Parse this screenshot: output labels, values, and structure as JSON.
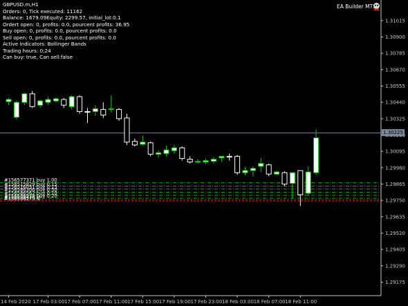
{
  "window": {
    "symbol_title": "GBPUSD.m,H1",
    "ea_label": "EA Builder MTS"
  },
  "info_lines": [
    "Orders: 0, Tick executed: 11162",
    "Balance: 1679.09Equity: 2299.57, initial_lot:0.1",
    "Ordert open: 0, profits: 0.0, pourcent profits: 36.95",
    "Buy open: 0, profits: 0.0, pourcent profits: 0.0",
    "Sell open: 0, profits: 0.0, pourcent profits: 0.0",
    "Active indicators: Bollinger Bands",
    "Trading hours: 0;24",
    "Can buy: true, Can sell:false"
  ],
  "colors": {
    "background": "#000000",
    "axis": "#c8c8c8",
    "bull_body": "#ffffff",
    "bear_body": "#000000",
    "wick_bull": "#00c800",
    "wick_bear": "#ffffff",
    "order_line": "#00aa00",
    "stop_line": "#ff0000",
    "bid_line": "#778899"
  },
  "chart_data": {
    "type": "candlestick",
    "symbol": "GBPUSD.m",
    "timeframe": "H1",
    "ylim": [
      1.2908,
      1.3116
    ],
    "y_ticks": [
      "1.31015",
      "1.30900",
      "1.30785",
      "1.30670",
      "1.30555",
      "1.30440",
      "1.30325",
      "1.30210",
      "1.30095",
      "1.29980",
      "1.29865",
      "1.29750",
      "1.29635",
      "1.29520",
      "1.29405",
      "1.29290",
      "1.29175"
    ],
    "x_ticks": [
      {
        "bar": 0,
        "label": "14 Feb 2020"
      },
      {
        "bar": 5,
        "label": "17 Feb 03:00"
      },
      {
        "bar": 9,
        "label": "17 Feb 07:00"
      },
      {
        "bar": 13,
        "label": "17 Feb 11:00"
      },
      {
        "bar": 17,
        "label": "17 Feb 15:00"
      },
      {
        "bar": 21,
        "label": "17 Feb 19:00"
      },
      {
        "bar": 25,
        "label": "17 Feb 23:00"
      },
      {
        "bar": 29,
        "label": "18 Feb 03:00"
      },
      {
        "bar": 33,
        "label": "18 Feb 07:00"
      },
      {
        "bar": 37,
        "label": "18 Feb 11:00"
      }
    ],
    "candles": [
      {
        "o": 1.30445,
        "h": 1.3047,
        "l": 1.3042,
        "c": 1.3046
      },
      {
        "o": 1.30335,
        "h": 1.3045,
        "l": 1.3032,
        "c": 1.3044
      },
      {
        "o": 1.3044,
        "h": 1.3051,
        "l": 1.3042,
        "c": 1.305
      },
      {
        "o": 1.305,
        "h": 1.3052,
        "l": 1.304,
        "c": 1.3041
      },
      {
        "o": 1.3042,
        "h": 1.3046,
        "l": 1.304,
        "c": 1.3045
      },
      {
        "o": 1.3044,
        "h": 1.3048,
        "l": 1.3042,
        "c": 1.3046
      },
      {
        "o": 1.3045,
        "h": 1.30475,
        "l": 1.3044,
        "c": 1.30465
      },
      {
        "o": 1.3046,
        "h": 1.3047,
        "l": 1.304,
        "c": 1.3042
      },
      {
        "o": 1.3041,
        "h": 1.3049,
        "l": 1.3039,
        "c": 1.3048
      },
      {
        "o": 1.3048,
        "h": 1.3049,
        "l": 1.3036,
        "c": 1.30375
      },
      {
        "o": 1.30375,
        "h": 1.304,
        "l": 1.30295,
        "c": 1.3037
      },
      {
        "o": 1.30375,
        "h": 1.3042,
        "l": 1.30345,
        "c": 1.30395
      },
      {
        "o": 1.3039,
        "h": 1.3044,
        "l": 1.3033,
        "c": 1.3035
      },
      {
        "o": 1.30395,
        "h": 1.3049,
        "l": 1.3037,
        "c": 1.30395
      },
      {
        "o": 1.3039,
        "h": 1.304,
        "l": 1.3031,
        "c": 1.30325
      },
      {
        "o": 1.3033,
        "h": 1.3036,
        "l": 1.3014,
        "c": 1.3016
      },
      {
        "o": 1.30165,
        "h": 1.30185,
        "l": 1.3013,
        "c": 1.3014
      },
      {
        "o": 1.30145,
        "h": 1.30205,
        "l": 1.30135,
        "c": 1.3016
      },
      {
        "o": 1.30155,
        "h": 1.30165,
        "l": 1.3006,
        "c": 1.30075
      },
      {
        "o": 1.30075,
        "h": 1.301,
        "l": 1.3005,
        "c": 1.30085
      },
      {
        "o": 1.3008,
        "h": 1.30135,
        "l": 1.3006,
        "c": 1.30105
      },
      {
        "o": 1.301,
        "h": 1.3014,
        "l": 1.3008,
        "c": 1.3012
      },
      {
        "o": 1.3012,
        "h": 1.3013,
        "l": 1.3003,
        "c": 1.30045
      },
      {
        "o": 1.3004,
        "h": 1.3006,
        "l": 1.3001,
        "c": 1.3002
      },
      {
        "o": 1.3002,
        "h": 1.3004,
        "l": 1.3001,
        "c": 1.30025
      },
      {
        "o": 1.3002,
        "h": 1.30045,
        "l": 1.30005,
        "c": 1.3003
      },
      {
        "o": 1.30025,
        "h": 1.30055,
        "l": 1.3001,
        "c": 1.3004
      },
      {
        "o": 1.3005,
        "h": 1.3006,
        "l": 1.3002,
        "c": 1.3006
      },
      {
        "o": 1.3006,
        "h": 1.3008,
        "l": 1.3003,
        "c": 1.30055
      },
      {
        "o": 1.3006,
        "h": 1.3007,
        "l": 1.2993,
        "c": 1.29945
      },
      {
        "o": 1.29945,
        "h": 1.29985,
        "l": 1.2993,
        "c": 1.2996
      },
      {
        "o": 1.2996,
        "h": 1.2999,
        "l": 1.2992,
        "c": 1.29975
      },
      {
        "o": 1.2999,
        "h": 1.3005,
        "l": 1.2995,
        "c": 1.3001
      },
      {
        "o": 1.3,
        "h": 1.3001,
        "l": 1.2992,
        "c": 1.29935
      },
      {
        "o": 1.29935,
        "h": 1.2996,
        "l": 1.2993,
        "c": 1.2995
      },
      {
        "o": 1.29945,
        "h": 1.29955,
        "l": 1.2985,
        "c": 1.29865
      },
      {
        "o": 1.2987,
        "h": 1.29945,
        "l": 1.2976,
        "c": 1.29945
      },
      {
        "o": 1.2996,
        "h": 1.2995,
        "l": 1.2971,
        "c": 1.2979
      },
      {
        "o": 1.298,
        "h": 1.2999,
        "l": 1.2978,
        "c": 1.2995
      },
      {
        "o": 1.29945,
        "h": 1.3025,
        "l": 1.2993,
        "c": 1.3019
      }
    ],
    "current_bid": {
      "value": 1.30225,
      "label": "1.30225"
    },
    "horizontal_levels": [
      {
        "value": 1.29875,
        "label": "#156577371 buy 1.00",
        "style": "order"
      },
      {
        "value": 1.2985,
        "label": "#156515829 buy 0.15",
        "style": "order"
      },
      {
        "value": 1.2983,
        "label": "#156516031 buy 0.15",
        "style": "order"
      },
      {
        "value": 1.29808,
        "label": "#156586306 buy 0.50",
        "style": "order"
      },
      {
        "value": 1.29785,
        "label": "#156586562 buy 0.10",
        "style": "order"
      },
      {
        "value": 1.29765,
        "label": "#156586978 buy 0.20",
        "style": "order"
      },
      {
        "value": 1.29755,
        "label": "#156586476 sl",
        "style": "stop"
      },
      {
        "value": 1.29745,
        "label": "#156586279 sl",
        "style": "stop"
      }
    ]
  }
}
